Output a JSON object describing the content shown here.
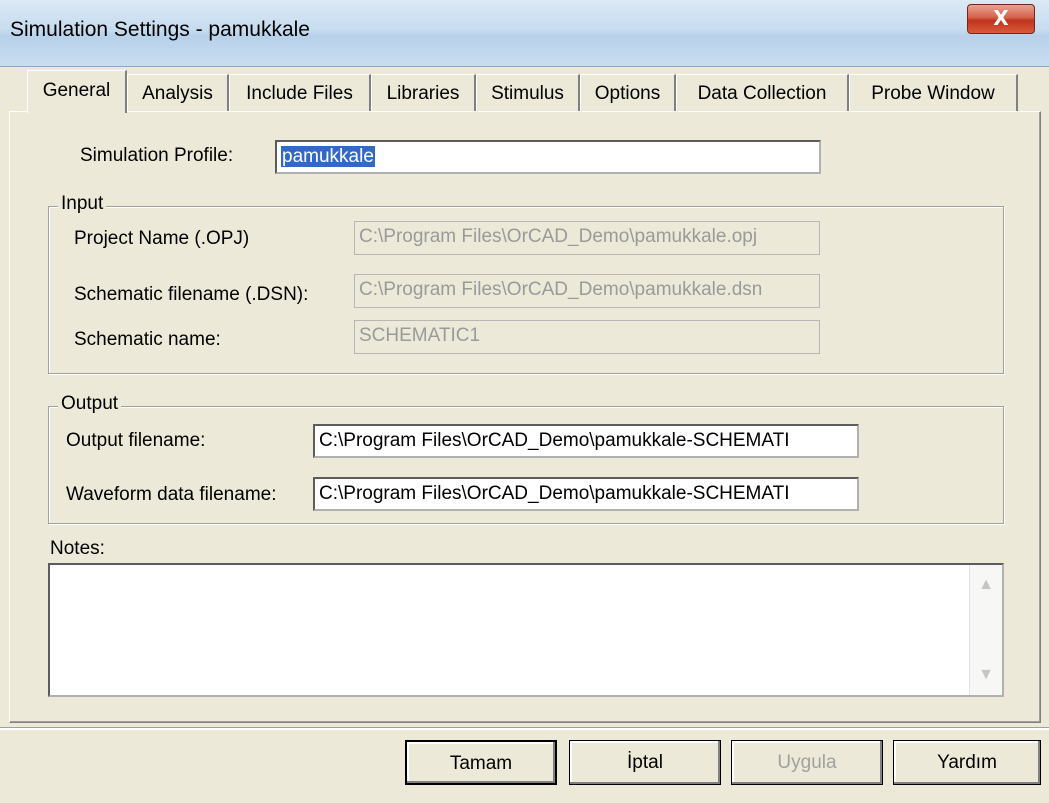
{
  "window": {
    "title": "Simulation Settings - pamukkale",
    "close_glyph": "X"
  },
  "tabs": [
    "General",
    "Analysis",
    "Include Files",
    "Libraries",
    "Stimulus",
    "Options",
    "Data Collection",
    "Probe Window"
  ],
  "active_tab": "General",
  "profile": {
    "label": "Simulation Profile:",
    "value": "pamukkale"
  },
  "input_group": {
    "legend": "Input",
    "project_label": "Project Name (.OPJ)",
    "project_value": "C:\\Program Files\\OrCAD_Demo\\pamukkale.opj",
    "schematic_file_label": "Schematic filename (.DSN):",
    "schematic_file_value": "C:\\Program Files\\OrCAD_Demo\\pamukkale.dsn",
    "schematic_name_label": "Schematic name:",
    "schematic_name_value": "SCHEMATIC1"
  },
  "output_group": {
    "legend": "Output",
    "output_label": "Output filename:",
    "output_value": "C:\\Program Files\\OrCAD_Demo\\pamukkale-SCHEMATI",
    "waveform_label": "Waveform data filename:",
    "waveform_value": "C:\\Program Files\\OrCAD_Demo\\pamukkale-SCHEMATI"
  },
  "notes": {
    "label": "Notes:",
    "value": "",
    "scroll_up_glyph": "▲",
    "scroll_down_glyph": "▼"
  },
  "buttons": {
    "ok": "Tamam",
    "cancel": "İptal",
    "apply": "Uygula",
    "help": "Yardım"
  }
}
